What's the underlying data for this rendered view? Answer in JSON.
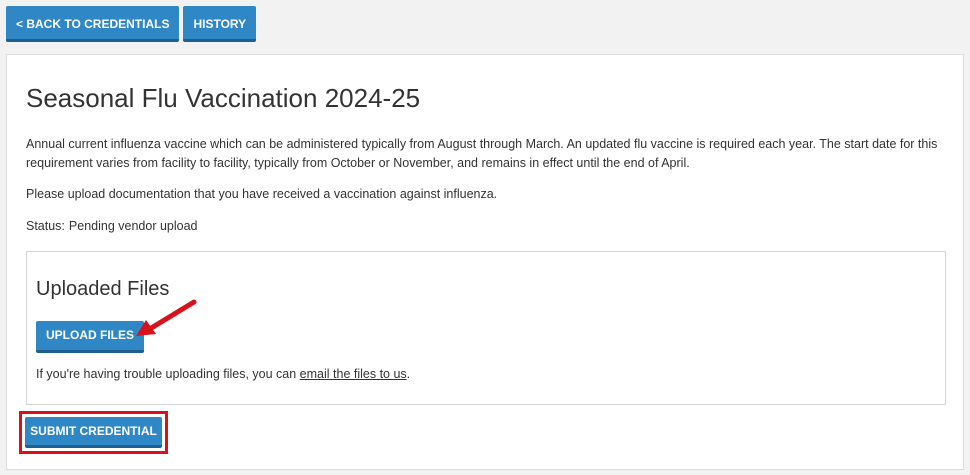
{
  "toolbar": {
    "back_label": "< BACK TO CREDENTIALS",
    "history_label": "HISTORY"
  },
  "credential": {
    "title": "Seasonal Flu Vaccination 2024-25",
    "description": "Annual current influenza vaccine which can be administered typically from August through March. An updated flu vaccine is required each year. The start date for this requirement varies from facility to facility, typically from October or November, and remains in effect until the end of April.",
    "instructions": "Please upload documentation that you have received a vaccination against influenza.",
    "status_label": "Status:",
    "status_value": "Pending vendor upload"
  },
  "uploaded_files": {
    "heading": "Uploaded Files",
    "upload_label": "UPLOAD FILES",
    "help_prefix": "If you're having trouble uploading files, you can ",
    "help_link": "email the files to us",
    "help_suffix": "."
  },
  "submit_label": "SUBMIT CREDENTIAL",
  "colors": {
    "button": "#2f87c5",
    "annotation": "#d8111c"
  }
}
